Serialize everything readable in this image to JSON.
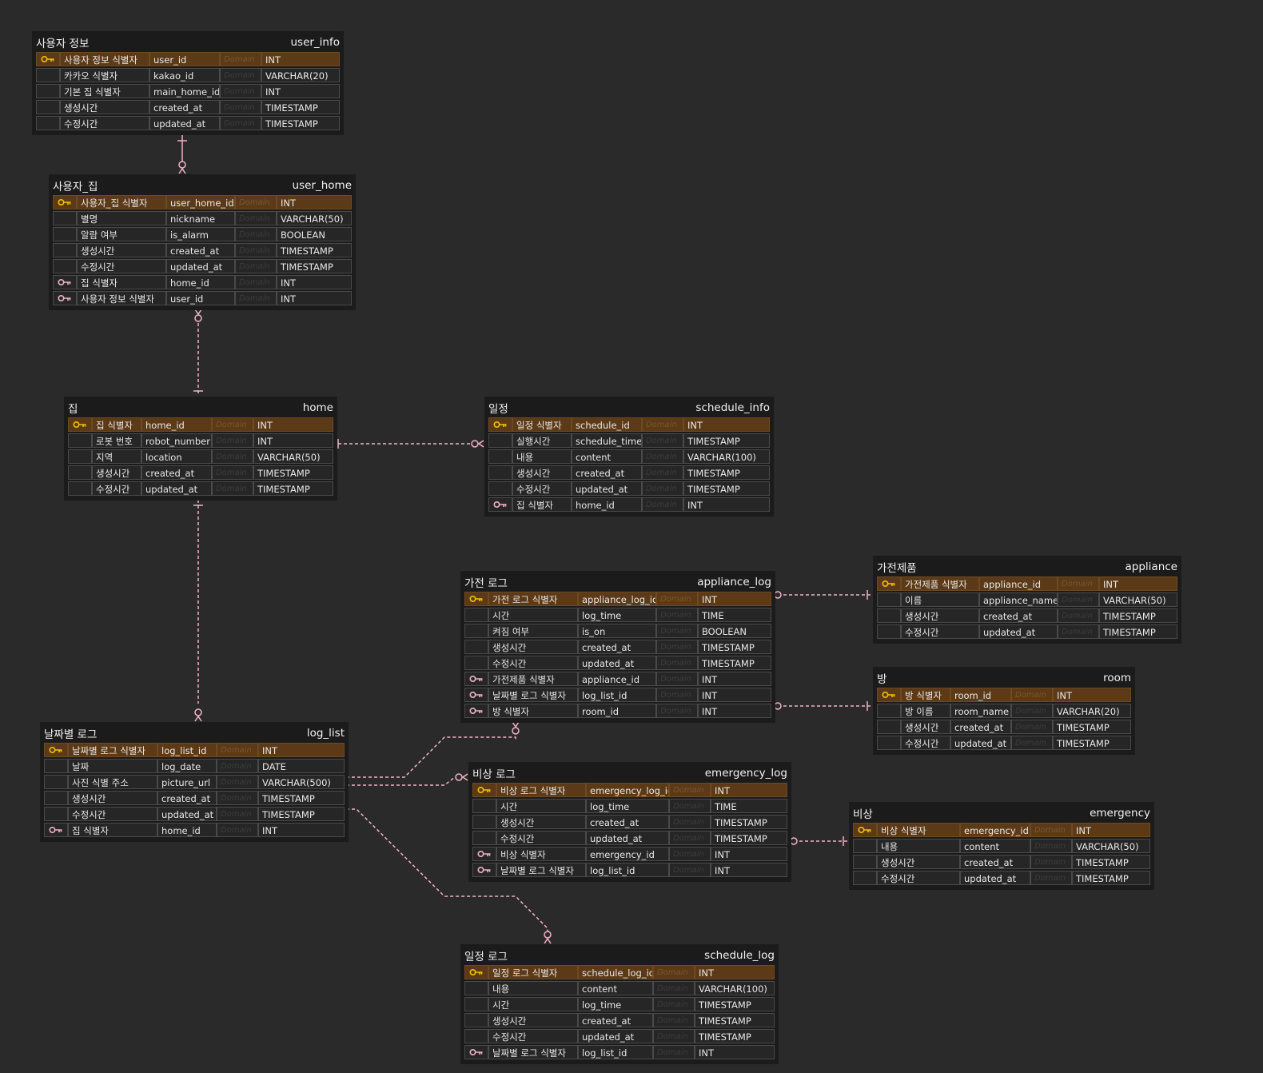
{
  "domain_placeholder": "Domain",
  "colors": {
    "background": "#2a2a2a",
    "table_header": "#1b1b1b",
    "pk_row": "#5c3a17",
    "relation_line": "#f2b3c8",
    "pk_key": "#f2c200",
    "fk_key": "#f0b0c6"
  },
  "entities": [
    {
      "id": "user_info",
      "title": "사용자 정보",
      "name": "user_info",
      "rows": [
        {
          "key": "pk",
          "label": "사용자 정보 식별자",
          "column": "user_id",
          "type": "INT"
        },
        {
          "key": "",
          "label": "카카오 식별자",
          "column": "kakao_id",
          "type": "VARCHAR(20)"
        },
        {
          "key": "",
          "label": "기본 집 식별자",
          "column": "main_home_id",
          "type": "INT"
        },
        {
          "key": "",
          "label": "생성시간",
          "column": "created_at",
          "type": "TIMESTAMP"
        },
        {
          "key": "",
          "label": "수정시간",
          "column": "updated_at",
          "type": "TIMESTAMP"
        }
      ]
    },
    {
      "id": "user_home",
      "title": "사용자_집",
      "name": "user_home",
      "rows": [
        {
          "key": "pk",
          "label": "사용자_집 식별자",
          "column": "user_home_id",
          "type": "INT"
        },
        {
          "key": "",
          "label": "별명",
          "column": "nickname",
          "type": "VARCHAR(50)"
        },
        {
          "key": "",
          "label": "알람 여부",
          "column": "is_alarm",
          "type": "BOOLEAN"
        },
        {
          "key": "",
          "label": "생성시간",
          "column": "created_at",
          "type": "TIMESTAMP"
        },
        {
          "key": "",
          "label": "수정시간",
          "column": "updated_at",
          "type": "TIMESTAMP"
        },
        {
          "key": "fk",
          "label": "집 식별자",
          "column": "home_id",
          "type": "INT"
        },
        {
          "key": "fk",
          "label": "사용자 정보 식별자",
          "column": "user_id",
          "type": "INT"
        }
      ]
    },
    {
      "id": "home",
      "title": "집",
      "name": "home",
      "rows": [
        {
          "key": "pk",
          "label": "집 식별자",
          "column": "home_id",
          "type": "INT"
        },
        {
          "key": "",
          "label": "로봇 번호",
          "column": "robot_number",
          "type": "INT"
        },
        {
          "key": "",
          "label": "지역",
          "column": "location",
          "type": "VARCHAR(50)"
        },
        {
          "key": "",
          "label": "생성시간",
          "column": "created_at",
          "type": "TIMESTAMP"
        },
        {
          "key": "",
          "label": "수정시간",
          "column": "updated_at",
          "type": "TIMESTAMP"
        }
      ]
    },
    {
      "id": "schedule_info",
      "title": "일정",
      "name": "schedule_info",
      "rows": [
        {
          "key": "pk",
          "label": "일정 식별자",
          "column": "schedule_id",
          "type": "INT"
        },
        {
          "key": "",
          "label": "실행시간",
          "column": "schedule_time",
          "type": "TIMESTAMP"
        },
        {
          "key": "",
          "label": "내용",
          "column": "content",
          "type": "VARCHAR(100)"
        },
        {
          "key": "",
          "label": "생성시간",
          "column": "created_at",
          "type": "TIMESTAMP"
        },
        {
          "key": "",
          "label": "수정시간",
          "column": "updated_at",
          "type": "TIMESTAMP"
        },
        {
          "key": "fk",
          "label": "집 식별자",
          "column": "home_id",
          "type": "INT"
        }
      ]
    },
    {
      "id": "appliance_log",
      "title": "가전 로그",
      "name": "appliance_log",
      "rows": [
        {
          "key": "pk",
          "label": "가전 로그 식별자",
          "column": "appliance_log_id",
          "type": "INT"
        },
        {
          "key": "",
          "label": "시간",
          "column": "log_time",
          "type": "TIME"
        },
        {
          "key": "",
          "label": "켜짐 여부",
          "column": "is_on",
          "type": "BOOLEAN"
        },
        {
          "key": "",
          "label": "생성시간",
          "column": "created_at",
          "type": "TIMESTAMP"
        },
        {
          "key": "",
          "label": "수정시간",
          "column": "updated_at",
          "type": "TIMESTAMP"
        },
        {
          "key": "fk",
          "label": "가전제품 식별자",
          "column": "appliance_id",
          "type": "INT"
        },
        {
          "key": "fk",
          "label": "날짜별 로그 식별자",
          "column": "log_list_id",
          "type": "INT"
        },
        {
          "key": "fk",
          "label": "방 식별자",
          "column": "room_id",
          "type": "INT"
        }
      ]
    },
    {
      "id": "appliance",
      "title": "가전제품",
      "name": "appliance",
      "rows": [
        {
          "key": "pk",
          "label": "가전제품 식별자",
          "column": "appliance_id",
          "type": "INT"
        },
        {
          "key": "",
          "label": "이름",
          "column": "appliance_name",
          "type": "VARCHAR(50)"
        },
        {
          "key": "",
          "label": "생성시간",
          "column": "created_at",
          "type": "TIMESTAMP"
        },
        {
          "key": "",
          "label": "수정시간",
          "column": "updated_at",
          "type": "TIMESTAMP"
        }
      ]
    },
    {
      "id": "room",
      "title": "방",
      "name": "room",
      "rows": [
        {
          "key": "pk",
          "label": "방 식별자",
          "column": "room_id",
          "type": "INT"
        },
        {
          "key": "",
          "label": "방 이름",
          "column": "room_name",
          "type": "VARCHAR(20)"
        },
        {
          "key": "",
          "label": "생성시간",
          "column": "created_at",
          "type": "TIMESTAMP"
        },
        {
          "key": "",
          "label": "수정시간",
          "column": "updated_at",
          "type": "TIMESTAMP"
        }
      ]
    },
    {
      "id": "log_list",
      "title": "날짜별 로그",
      "name": "log_list",
      "rows": [
        {
          "key": "pk",
          "label": "날짜별 로그 식별자",
          "column": "log_list_id",
          "type": "INT"
        },
        {
          "key": "",
          "label": "날짜",
          "column": "log_date",
          "type": "DATE"
        },
        {
          "key": "",
          "label": "사진 식별 주소",
          "column": "picture_url",
          "type": "VARCHAR(500)"
        },
        {
          "key": "",
          "label": "생성시간",
          "column": "created_at",
          "type": "TIMESTAMP"
        },
        {
          "key": "",
          "label": "수정시간",
          "column": "updated_at",
          "type": "TIMESTAMP"
        },
        {
          "key": "fk",
          "label": "집 식별자",
          "column": "home_id",
          "type": "INT"
        }
      ]
    },
    {
      "id": "emergency_log",
      "title": "비상 로그",
      "name": "emergency_log",
      "rows": [
        {
          "key": "pk",
          "label": "비상 로그 식별자",
          "column": "emergency_log_id",
          "type": "INT"
        },
        {
          "key": "",
          "label": "시간",
          "column": "log_time",
          "type": "TIME"
        },
        {
          "key": "",
          "label": "생성시간",
          "column": "created_at",
          "type": "TIMESTAMP"
        },
        {
          "key": "",
          "label": "수정시간",
          "column": "updated_at",
          "type": "TIMESTAMP"
        },
        {
          "key": "fk",
          "label": "비상 식별자",
          "column": "emergency_id",
          "type": "INT"
        },
        {
          "key": "fk",
          "label": "날짜별 로그 식별자",
          "column": "log_list_id",
          "type": "INT"
        }
      ]
    },
    {
      "id": "emergency",
      "title": "비상",
      "name": "emergency",
      "rows": [
        {
          "key": "pk",
          "label": "비상 식별자",
          "column": "emergency_id",
          "type": "INT"
        },
        {
          "key": "",
          "label": "내용",
          "column": "content",
          "type": "VARCHAR(50)"
        },
        {
          "key": "",
          "label": "생성시간",
          "column": "created_at",
          "type": "TIMESTAMP"
        },
        {
          "key": "",
          "label": "수정시간",
          "column": "updated_at",
          "type": "TIMESTAMP"
        }
      ]
    },
    {
      "id": "schedule_log",
      "title": "일정 로그",
      "name": "schedule_log",
      "rows": [
        {
          "key": "pk",
          "label": "일정 로그 식별자",
          "column": "schedule_log_id",
          "type": "INT"
        },
        {
          "key": "",
          "label": "내용",
          "column": "content",
          "type": "VARCHAR(100)"
        },
        {
          "key": "",
          "label": "시간",
          "column": "log_time",
          "type": "TIMESTAMP"
        },
        {
          "key": "",
          "label": "생성시간",
          "column": "created_at",
          "type": "TIMESTAMP"
        },
        {
          "key": "",
          "label": "수정시간",
          "column": "updated_at",
          "type": "TIMESTAMP"
        },
        {
          "key": "fk",
          "label": "날짜별 로그 식별자",
          "column": "log_list_id",
          "type": "INT"
        }
      ]
    }
  ],
  "relationships": [
    {
      "from": "user_info",
      "to": "user_home",
      "from_card": "one",
      "to_card": "zero-or-many",
      "line": "solid"
    },
    {
      "from": "user_home",
      "to": "home",
      "from_card": "zero-or-many",
      "to_card": "one",
      "line": "dashed"
    },
    {
      "from": "home",
      "to": "schedule_info",
      "from_card": "one",
      "to_card": "zero-or-many",
      "line": "dashed"
    },
    {
      "from": "home",
      "to": "log_list",
      "from_card": "one",
      "to_card": "zero-or-many",
      "line": "dashed"
    },
    {
      "from": "appliance",
      "to": "appliance_log",
      "from_card": "one",
      "to_card": "zero-or-many",
      "line": "dashed"
    },
    {
      "from": "room",
      "to": "appliance_log",
      "from_card": "one",
      "to_card": "zero-or-many",
      "line": "dashed"
    },
    {
      "from": "log_list",
      "to": "appliance_log",
      "from_card": "one",
      "to_card": "zero-or-many",
      "line": "dashed"
    },
    {
      "from": "log_list",
      "to": "emergency_log",
      "from_card": "one",
      "to_card": "zero-or-many",
      "line": "dashed"
    },
    {
      "from": "log_list",
      "to": "schedule_log",
      "from_card": "one",
      "to_card": "zero-or-many",
      "line": "dashed"
    },
    {
      "from": "emergency",
      "to": "emergency_log",
      "from_card": "one",
      "to_card": "zero-or-many",
      "line": "dashed"
    }
  ]
}
